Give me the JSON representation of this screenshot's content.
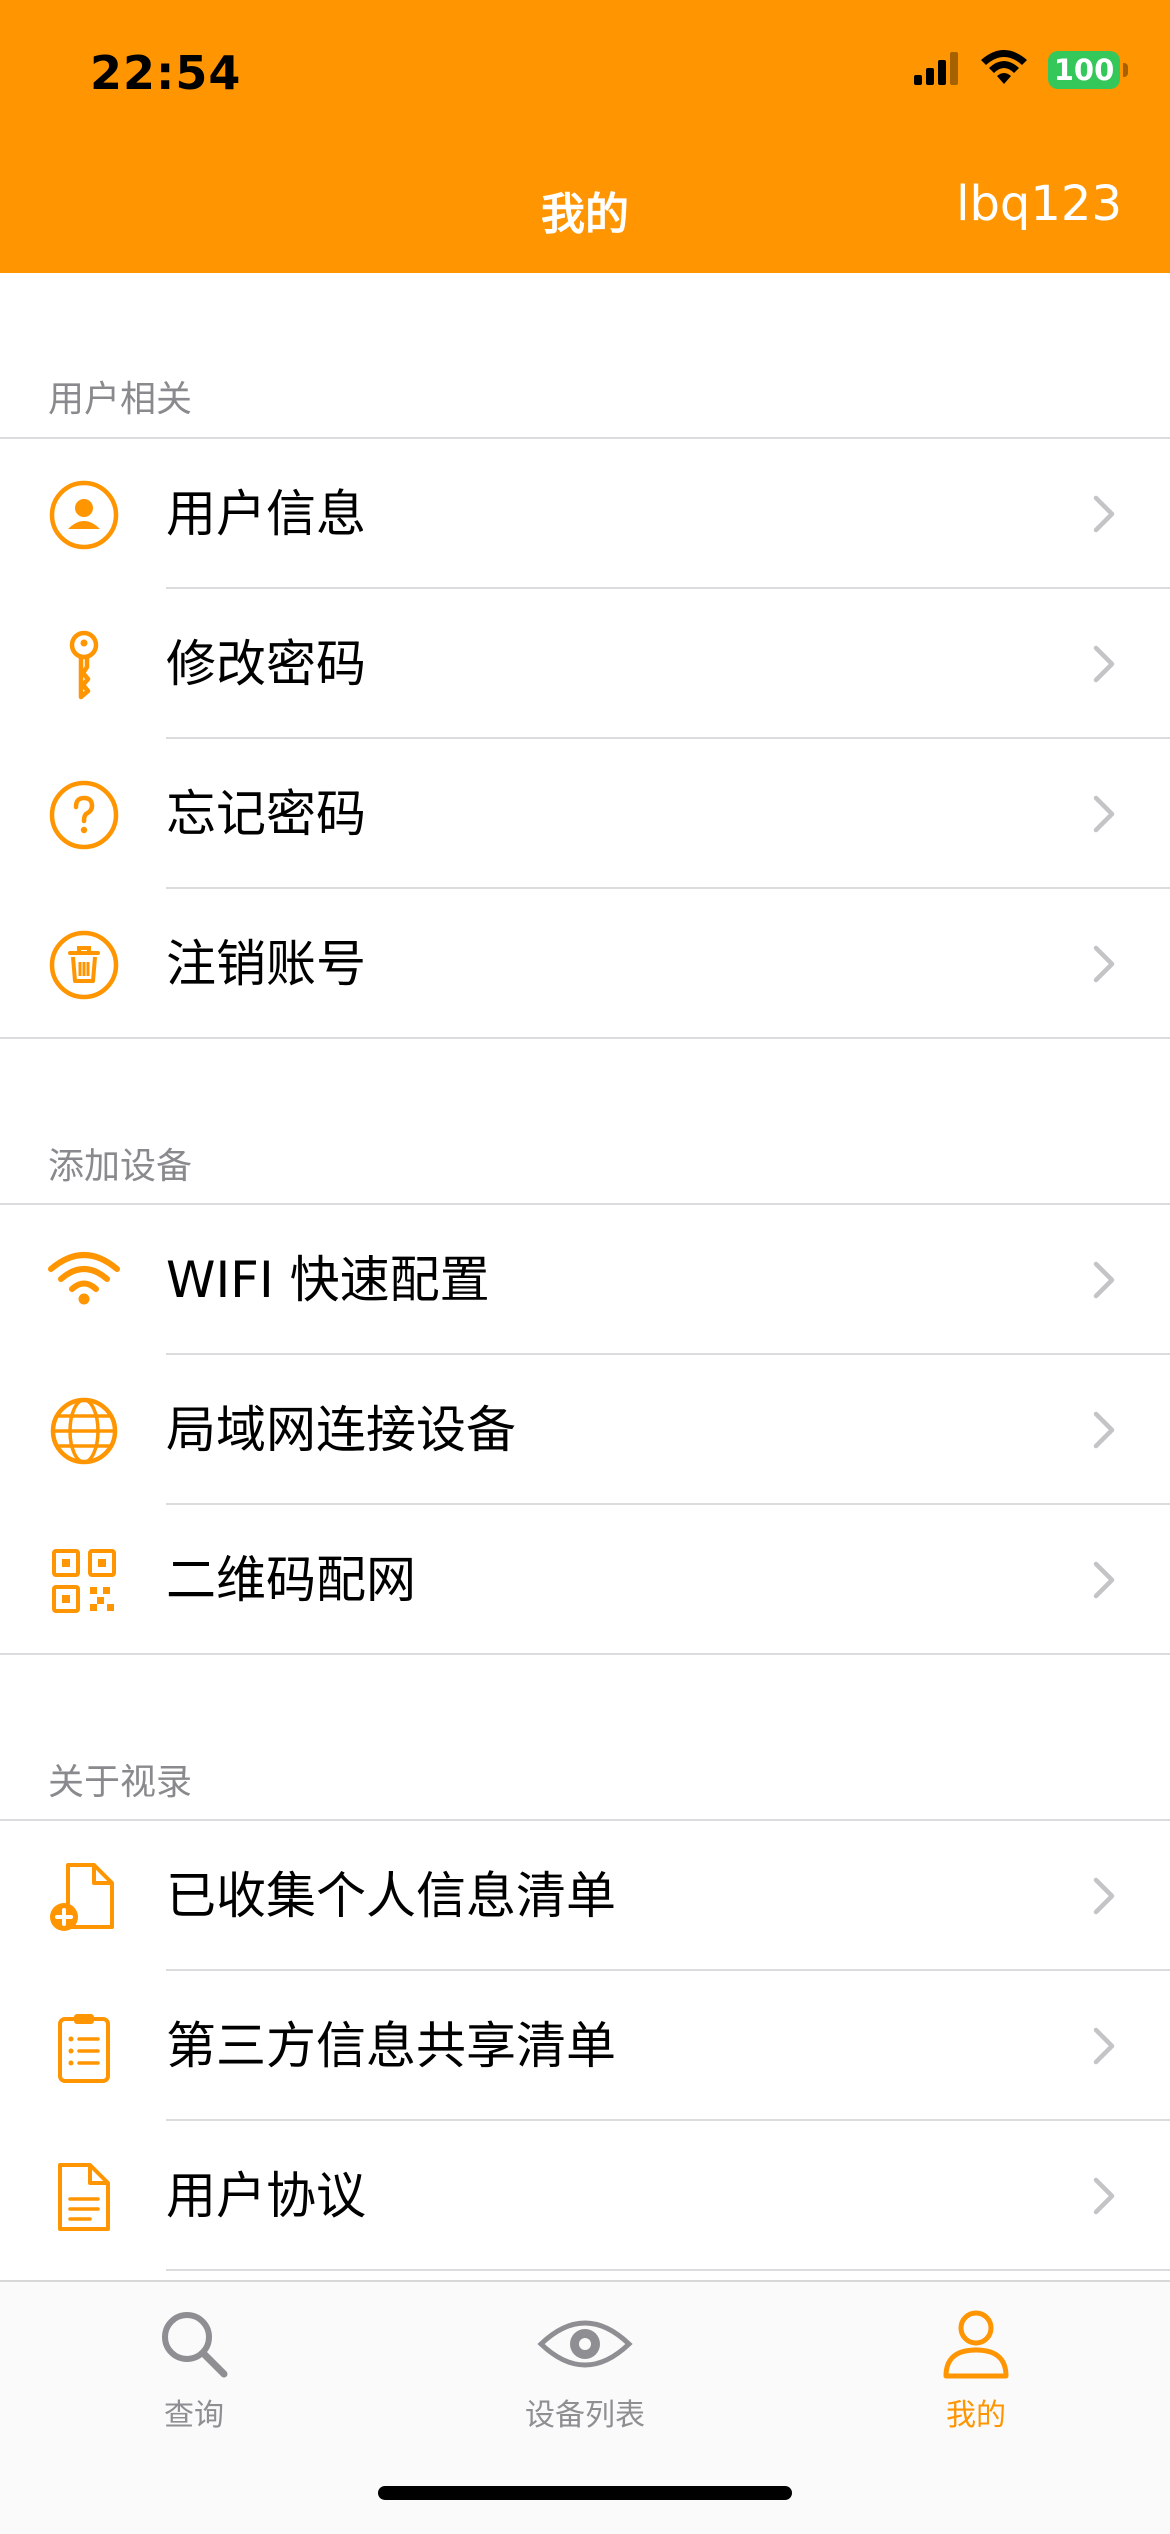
{
  "status_bar": {
    "time": "22:54",
    "battery": "100"
  },
  "nav": {
    "title": "我的",
    "username": "lbq123"
  },
  "sections": [
    {
      "header": "用户相关",
      "items": [
        {
          "label": "用户信息",
          "icon": "user-circle-icon"
        },
        {
          "label": "修改密码",
          "icon": "key-icon"
        },
        {
          "label": "忘记密码",
          "icon": "question-circle-icon"
        },
        {
          "label": "注销账号",
          "icon": "trash-circle-icon"
        }
      ]
    },
    {
      "header": "添加设备",
      "items": [
        {
          "label": "WIFI 快速配置",
          "icon": "wifi-icon"
        },
        {
          "label": "局域网连接设备",
          "icon": "globe-icon"
        },
        {
          "label": "二维码配网",
          "icon": "qr-code-icon"
        }
      ]
    },
    {
      "header": "关于视录",
      "items": [
        {
          "label": "已收集个人信息清单",
          "icon": "file-add-icon"
        },
        {
          "label": "第三方信息共享清单",
          "icon": "clipboard-list-icon"
        },
        {
          "label": "用户协议",
          "icon": "document-icon"
        }
      ]
    }
  ],
  "tabs": [
    {
      "label": "查询",
      "icon": "search-icon",
      "active": false
    },
    {
      "label": "设备列表",
      "icon": "eye-icon",
      "active": false
    },
    {
      "label": "我的",
      "icon": "person-icon",
      "active": true
    }
  ],
  "colors": {
    "accent": "#ff9500",
    "tab_inactive": "#8e8e93",
    "battery": "#34c759"
  }
}
